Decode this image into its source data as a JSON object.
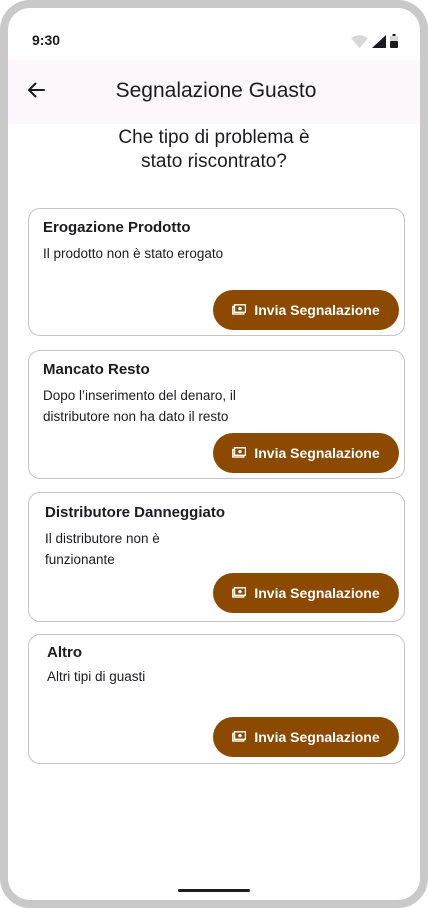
{
  "status_bar": {
    "time": "9:30",
    "icons": [
      "wifi-icon",
      "signal-icon",
      "battery-icon"
    ]
  },
  "app_bar": {
    "back_icon": "arrow-back-icon",
    "title": "Segnalazione Guasto"
  },
  "question": {
    "line1": "Che tipo di problema è",
    "line2": "stato riscontrato?"
  },
  "cards": [
    {
      "title": "Erogazione Prodotto",
      "description": "Il prodotto non è stato erogato",
      "button_label": "Invia Segnalazione",
      "button_icon": "money-icon"
    },
    {
      "title": "Mancato Resto",
      "description": "Dopo l’inserimento del denaro, il distributore non ha dato il resto",
      "button_label": "Invia Segnalazione",
      "button_icon": "money-icon"
    },
    {
      "title": "Distributore Danneggiato",
      "description": "Il distributore non è funzionante",
      "button_label": "Invia Segnalazione",
      "button_icon": "money-icon"
    },
    {
      "title": "Altro",
      "description": "Altri tipi di guasti",
      "button_label": "Invia Segnalazione",
      "button_icon": "money-icon"
    }
  ],
  "colors": {
    "accent": "#8b4a00",
    "app_bar_bg": "#fdf7fb",
    "card_border": "#c7c3c9",
    "text": "#1c1b1f"
  }
}
